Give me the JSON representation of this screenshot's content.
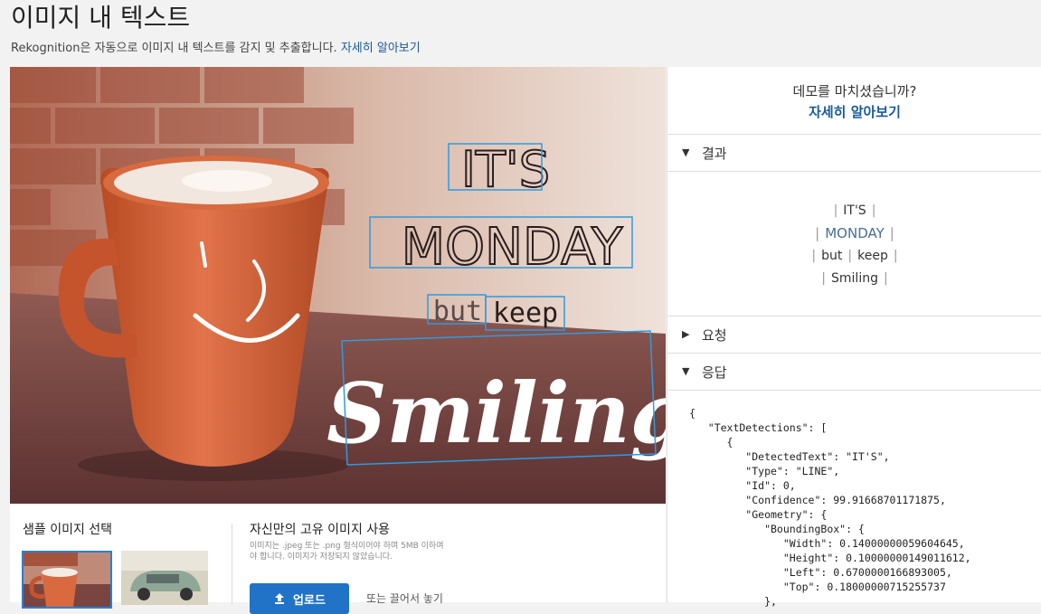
{
  "header": {
    "title": "이미지 내 텍스트",
    "description": "Rekognition은 자동으로 이미지 내 텍스트를 감지 및 추출합니다.",
    "learn_more": "자세히 알아보기"
  },
  "image": {
    "words": [
      "IT'S",
      "MONDAY",
      "but",
      "keep",
      "Smiling"
    ],
    "box_color": "#2d9be0"
  },
  "samples": {
    "title": "샘플 이미지 선택",
    "thumbs": [
      "coffee-mug",
      "green-car"
    ]
  },
  "own": {
    "title": "자신만의 고유 이미지 사용",
    "description": "이미지는 .jpeg 또는 .png 형식이어야 하며 5MB 이하여야 합니다. 이미지가 저장되지 않았습니다.",
    "upload_label": "업로드",
    "drop_label": "또는 끌어서 놓기"
  },
  "side": {
    "done_text": "데모를 마치셨습니까?",
    "learn_more": "자세히 알아보기",
    "sections": {
      "result": "결과",
      "request": "요청",
      "response": "응답"
    },
    "result_lines": [
      [
        "IT'S"
      ],
      [
        "MONDAY"
      ],
      [
        "but",
        "keep"
      ],
      [
        "Smiling"
      ]
    ],
    "response_json": [
      "{",
      "   \"TextDetections\": [",
      "      {",
      "         \"DetectedText\": \"IT'S\",",
      "         \"Type\": \"LINE\",",
      "         \"Id\": 0,",
      "         \"Confidence\": 99.91668701171875,",
      "         \"Geometry\": {",
      "            \"BoundingBox\": {",
      "               \"Width\": 0.14000000059604645,",
      "               \"Height\": 0.10000000149011612,",
      "               \"Left\": 0.6700000166893005,",
      "               \"Top\": 0.18000000715255737",
      "            },"
    ]
  },
  "colors": {
    "accent": "#2073c6",
    "link": "#1a5a99",
    "selection": "#2d7fcf"
  }
}
